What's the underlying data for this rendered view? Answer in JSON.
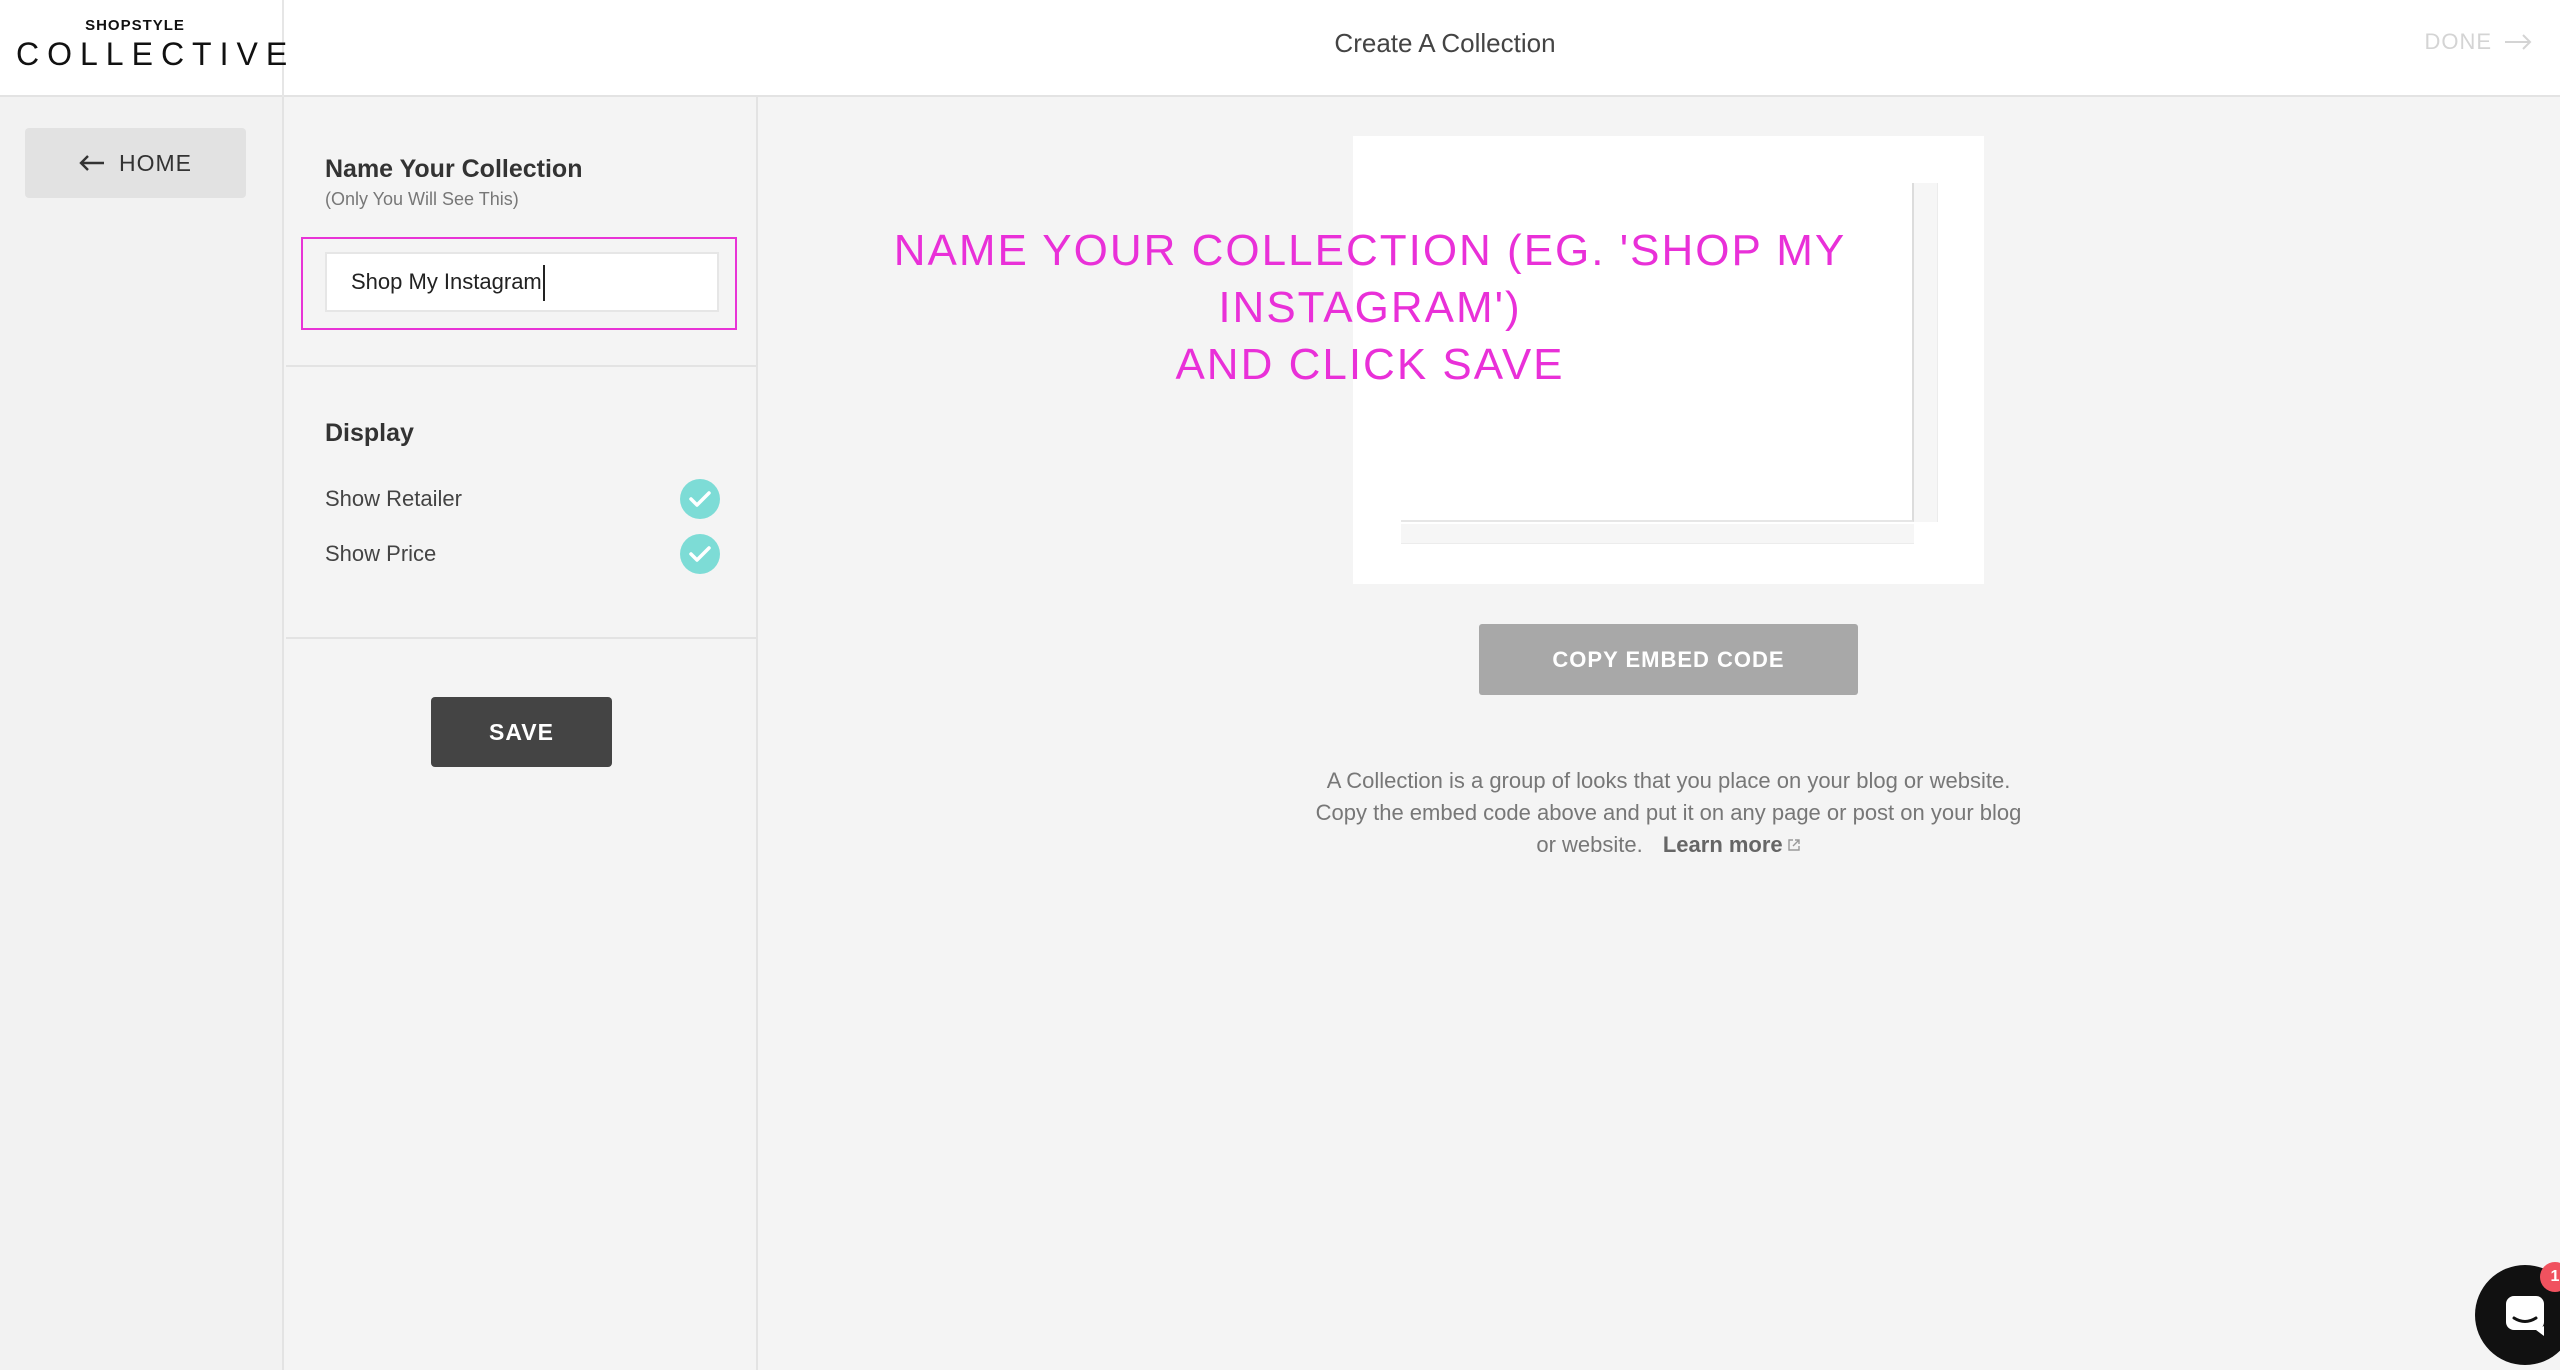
{
  "logo": {
    "top": "SHOPSTYLE",
    "main": "COLLECTIVE"
  },
  "header": {
    "title": "Create A Collection",
    "done_label": "DONE"
  },
  "nav": {
    "home_label": "HOME"
  },
  "settings": {
    "name_title": "Name Your Collection",
    "name_subtitle": "(Only You Will See This)",
    "name_value": "Shop My Instagram",
    "display_title": "Display",
    "options": [
      {
        "label": "Show Retailer",
        "checked": true
      },
      {
        "label": "Show Price",
        "checked": true
      }
    ],
    "save_label": "SAVE"
  },
  "overlay": {
    "line1": "NAME YOUR COLLECTION (EG. 'SHOP MY INSTAGRAM')",
    "line2": "AND CLICK SAVE",
    "color": "#e930d8"
  },
  "main": {
    "copy_button_label": "COPY EMBED CODE",
    "help_text": "A Collection is a group of looks that you place on your blog or website. Copy the embed code above and put it on any page or post on your blog or website.",
    "learn_more_label": "Learn more"
  },
  "chat": {
    "badge_count": "1"
  },
  "colors": {
    "accent_check": "#7ddcd6",
    "save_button": "#444444",
    "copy_button_disabled": "#a8a8a8",
    "highlight": "#e833d6"
  },
  "icons": {
    "home": "arrow-left-icon",
    "done": "arrow-right-icon",
    "check": "check-icon",
    "learn_more": "external-link-icon",
    "chat": "chat-icon"
  }
}
